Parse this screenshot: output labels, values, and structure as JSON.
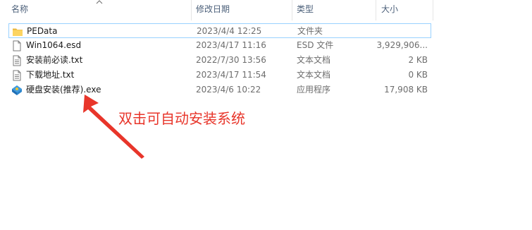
{
  "columns": {
    "name": "名称",
    "modified": "修改日期",
    "type": "类型",
    "size": "大小"
  },
  "files": [
    {
      "name": "PEData",
      "modified": "2023/4/4 12:25",
      "type": "文件夹",
      "size": "",
      "icon": "folder-icon",
      "selected": true
    },
    {
      "name": "Win1064.esd",
      "modified": "2023/4/17 11:16",
      "type": "ESD 文件",
      "size": "3,929,906...",
      "icon": "file-icon"
    },
    {
      "name": "安装前必读.txt",
      "modified": "2022/7/30 13:56",
      "type": "文本文档",
      "size": "2 KB",
      "icon": "text-file-icon"
    },
    {
      "name": "下载地址.txt",
      "modified": "2023/4/17 11:54",
      "type": "文本文档",
      "size": "0 KB",
      "icon": "text-file-icon"
    },
    {
      "name": "硬盘安装(推荐).exe",
      "modified": "2023/4/6 10:22",
      "type": "应用程序",
      "size": "17,908 KB",
      "icon": "installer-exe-icon"
    }
  ],
  "annotation": {
    "text": "双击可自动安装系统",
    "color": "#e8352a"
  }
}
